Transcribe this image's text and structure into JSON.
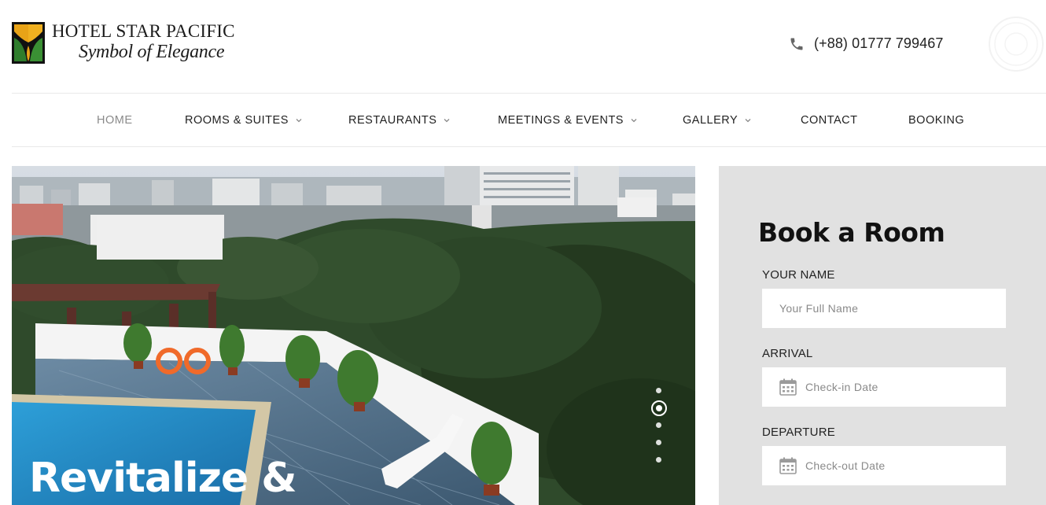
{
  "brand": {
    "name": "HOTEL STAR PACIFIC",
    "tagline": "Symbol of Elegance",
    "logo_icon": "hotel-leaf-logo",
    "colors": {
      "gold": "#e8a317",
      "green": "#2f7d2c",
      "black": "#111111"
    }
  },
  "contact": {
    "phone_icon": "phone-icon",
    "phone": "(+88) 01777 799467"
  },
  "nav": {
    "items": [
      {
        "label": "HOME",
        "active": true,
        "has_dropdown": false
      },
      {
        "label": "ROOMS & SUITES",
        "active": false,
        "has_dropdown": true
      },
      {
        "label": "RESTAURANTS",
        "active": false,
        "has_dropdown": true
      },
      {
        "label": "MEETINGS & EVENTS",
        "active": false,
        "has_dropdown": true
      },
      {
        "label": "GALLERY",
        "active": false,
        "has_dropdown": true
      },
      {
        "label": "CONTACT",
        "active": false,
        "has_dropdown": false
      },
      {
        "label": "BOOKING",
        "active": false,
        "has_dropdown": false
      }
    ]
  },
  "hero": {
    "title": "Revitalize &",
    "image": "rooftop-pool-city-view",
    "slides": {
      "count": 5,
      "active": 2
    }
  },
  "booking": {
    "title": "Book a Room",
    "panel_color": "#e1e1e1",
    "fields": {
      "name": {
        "label": "YOUR NAME",
        "placeholder": "Your Full Name",
        "value": ""
      },
      "arrival": {
        "label": "ARRIVAL",
        "placeholder": "Check-in Date",
        "value": "",
        "icon": "calendar-icon"
      },
      "departure": {
        "label": "DEPARTURE",
        "placeholder": "Check-out Date",
        "value": "",
        "icon": "calendar-icon"
      }
    }
  }
}
